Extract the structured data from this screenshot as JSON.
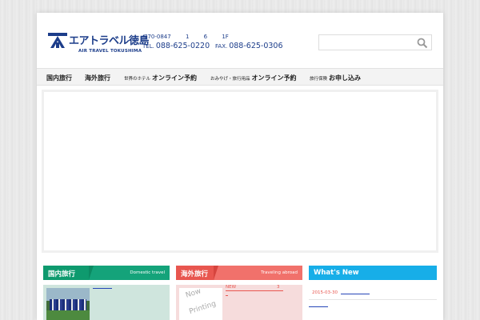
{
  "header": {
    "logo_text": "エアトラベル徳島",
    "logo_sub": "AIR TRAVEL TOKUSHIMA",
    "address": {
      "postal": "770-0847",
      "n1": "1",
      "n2": "6",
      "floor": "1F"
    },
    "tel_label": "TEL.",
    "tel": "088-625-0220",
    "fax_label": "FAX.",
    "fax": "088-625-0306",
    "search": {
      "placeholder": "",
      "value": ""
    }
  },
  "nav": {
    "items": [
      {
        "label": "国内旅行"
      },
      {
        "label": "海外旅行"
      },
      {
        "small": "世界のホテル",
        "big": "オンライン予約"
      },
      {
        "small": "おみやげ・旅行用品",
        "big": "オンライン予約"
      },
      {
        "small": "旅行保険",
        "big": "お申し込み"
      }
    ]
  },
  "sections": {
    "domestic": {
      "title": "国内旅行",
      "subtitle": "Domestic travel"
    },
    "abroad": {
      "title": "海外旅行",
      "subtitle": "Traveling abroad",
      "new_label": "NEW",
      "count": "3",
      "now_printing": [
        "Now",
        "Printing"
      ]
    },
    "whats_new": {
      "title": "What's New",
      "date": "2015-03-30"
    }
  },
  "colors": {
    "brand_blue": "#1c3d8a",
    "domestic_green": "#14a37a",
    "abroad_red": "#f1716b",
    "news_blue": "#17aee8"
  },
  "icons": {
    "search": "search-icon",
    "logo": "logo-mark-icon"
  }
}
